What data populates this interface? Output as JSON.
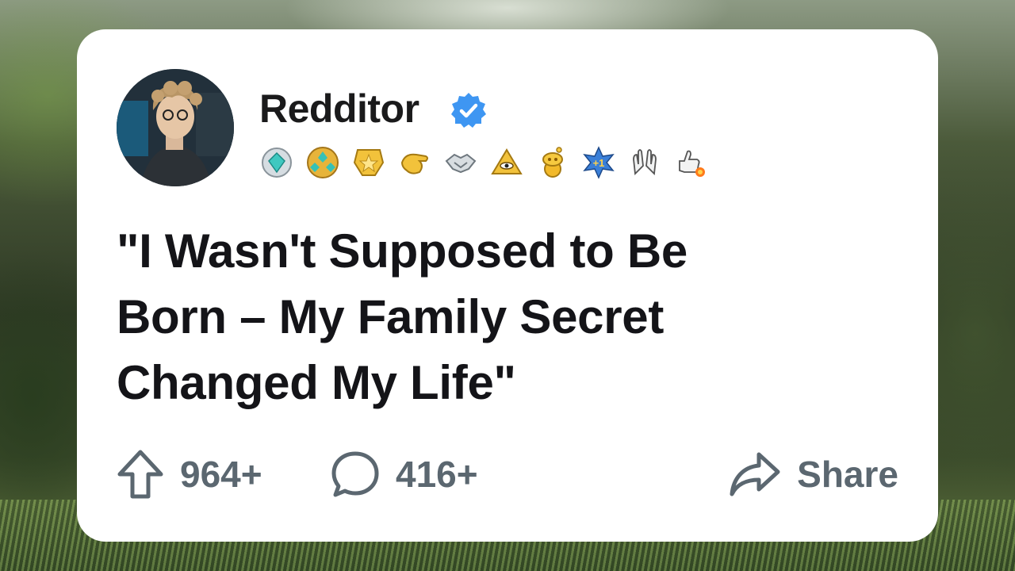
{
  "post": {
    "username": "Redditor",
    "verified_icon": "verified-badge-icon",
    "awards": [
      "silver-gem-award",
      "gem-cluster-award",
      "gold-star-award",
      "pointing-hand-award",
      "handshake-award",
      "pyramid-eye-award",
      "gold-snoo-award",
      "plus-one-award",
      "clapping-hands-award",
      "thumbs-up-rocket-award"
    ],
    "title_line1": "\"I Wasn't Supposed to Be",
    "title_line2": "Born – My Family Secret",
    "title_line3": "Changed My Life\"",
    "upvotes": "964+",
    "comments": "416+",
    "share_label": "Share"
  },
  "colors": {
    "card": "#ffffff",
    "text": "#141418",
    "muted": "#5b6770",
    "verified": "#3e96f2"
  }
}
